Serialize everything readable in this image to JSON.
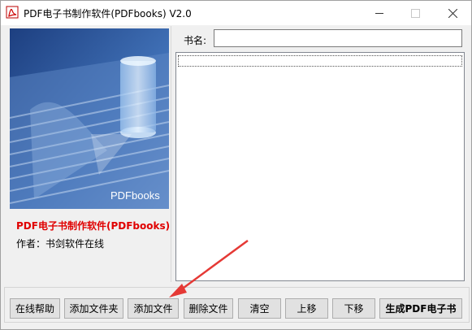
{
  "window": {
    "title": "PDF电子书制作软件(PDFbooks) V2.0"
  },
  "cover": {
    "caption": "PDFbooks"
  },
  "app_info": {
    "name": "PDF电子书制作软件(PDFbooks)",
    "author": "作者：书剑软件在线"
  },
  "form": {
    "book_name_label": "书名:",
    "book_name_value": ""
  },
  "file_list": {
    "items": []
  },
  "toolbar": {
    "help": "在线帮助",
    "add_folder": "添加文件夹",
    "add_file": "添加文件",
    "delete_file": "删除文件",
    "clear": "清空",
    "move_up": "上移",
    "move_down": "下移",
    "generate": "生成PDF电子书"
  },
  "colors": {
    "app_name": "#e00000",
    "annotation_arrow": "#e53935",
    "cover_blue": "#4a78b8"
  }
}
